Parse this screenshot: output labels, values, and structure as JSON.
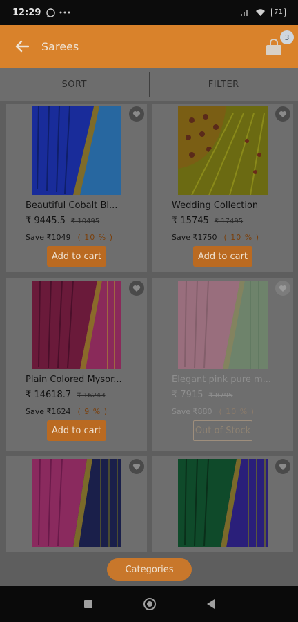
{
  "status_bar": {
    "time": "12:29",
    "battery": "71"
  },
  "app_bar": {
    "title": "Sarees",
    "cart_count": "3"
  },
  "sort_filter": {
    "sort_label": "SORT",
    "filter_label": "FILTER"
  },
  "products": [
    {
      "name": "Beautiful Cobalt Bl...",
      "price": "₹ 9445.5",
      "old_price": "₹ 10495",
      "save": "Save ₹1049",
      "discount": "( 10 % )",
      "action": "Add to cart"
    },
    {
      "name": "Wedding Collection",
      "price": "₹ 15745",
      "old_price": "₹ 17495",
      "save": "Save ₹1750",
      "discount": "( 10 % )",
      "action": "Add to cart"
    },
    {
      "name": "Plain Colored Mysor...",
      "price": "₹ 14618.7",
      "old_price": "₹ 16243",
      "save": "Save ₹1624",
      "discount": "( 9 % )",
      "action": "Add to cart"
    },
    {
      "name": "Elegant pink pure m...",
      "price": "₹ 7915",
      "old_price": "₹ 8795",
      "save": "Save ₹880",
      "discount": "( 10 % )",
      "action": "Out of Stock"
    }
  ],
  "categories_label": "Categories",
  "colors": {
    "accent": "#d9822b",
    "button": "#ba6a21"
  },
  "icons": [
    "back-arrow-icon",
    "cart-bag-icon",
    "heart-icon",
    "nav-recents-icon",
    "nav-home-icon",
    "nav-back-icon"
  ]
}
